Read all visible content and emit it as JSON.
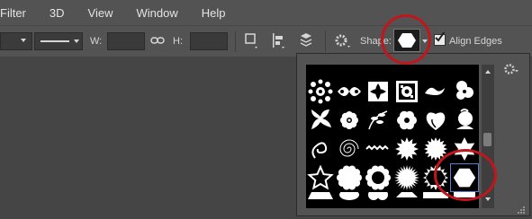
{
  "menu": {
    "items": [
      "Filter",
      "3D",
      "View",
      "Window",
      "Help"
    ]
  },
  "options": {
    "w_label": "W:",
    "h_label": "H:",
    "w_value": "",
    "h_value": "",
    "shape_label": "Shape:",
    "align_edges_label": "Align Edges",
    "align_edges_checked": true
  },
  "picker": {
    "shapes": [
      "ornament-a",
      "ornament-b",
      "ornament-c",
      "ornament-d",
      "ornament-e",
      "ornament-f",
      "frame-ornament",
      "fleuron",
      "square-ornament",
      "floral-tile",
      "scroll-ornament",
      "flower-ornament",
      "fleur-corner",
      "flower",
      "leaf-sprig",
      "flower-6",
      "heart-flourish",
      "flower-bud",
      "swirl",
      "spiral",
      "zigzag",
      "starburst-12",
      "starburst-16",
      "star-6",
      "star-5-outline",
      "scalloped-circle",
      "scalloped-ring",
      "starburst-24",
      "hexagon-ring",
      "hexagon",
      "triangle",
      "ellipse",
      "rounded-shape",
      "diamond",
      "wide-shape",
      "shape"
    ],
    "selected": "hexagon"
  },
  "colors": {
    "highlight": "#c0161c",
    "selection": "#5b80c8"
  }
}
